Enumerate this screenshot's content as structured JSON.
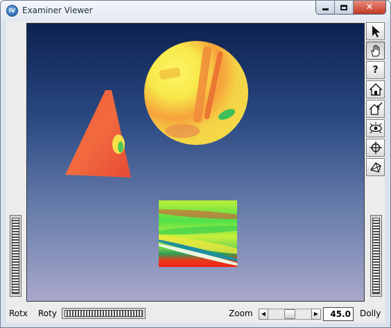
{
  "window": {
    "title": "Examiner Viewer",
    "app_icon_text": "IV",
    "caption_buttons": [
      "minimize",
      "maximize",
      "close"
    ]
  },
  "tools": [
    {
      "name": "pick-arrow-icon",
      "active": false
    },
    {
      "name": "hand-view-icon",
      "active": true
    },
    {
      "name": "help-icon",
      "label": "?",
      "active": false
    },
    {
      "name": "home-icon",
      "active": false
    },
    {
      "name": "set-home-icon",
      "active": false
    },
    {
      "name": "view-all-icon",
      "active": false
    },
    {
      "name": "seek-icon",
      "active": false
    },
    {
      "name": "camera-type-icon",
      "active": false
    }
  ],
  "bottom_bar": {
    "rotx_label": "Rotx",
    "roty_label": "Roty",
    "zoom_label": "Zoom",
    "zoom_value": "45.0",
    "dolly_label": "Dolly",
    "zoom_slider_position": 0.5
  },
  "scene": {
    "background_top": "#0c2150",
    "background_bottom": "#a8a7ca",
    "objects": [
      "textured-disc",
      "textured-triangle",
      "textured-square"
    ]
  }
}
